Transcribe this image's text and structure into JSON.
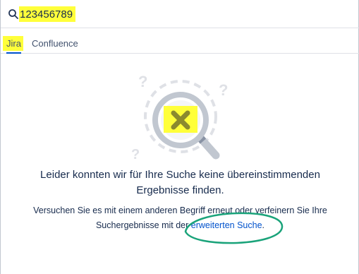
{
  "search": {
    "value": "123456789",
    "icon": "search-icon"
  },
  "tabs": [
    {
      "label": "Jira",
      "active": true
    },
    {
      "label": "Confluence",
      "active": false
    }
  ],
  "empty_state": {
    "title_line1": "Leider konnten wir für Ihre Suche keine übereinstimmenden",
    "title_line2": "Ergebnisse finden.",
    "body_line1": "Versuchen Sie es mit einem anderen Begriff erneut oder verfeinern Sie Ihre",
    "body_line2_prefix": "Suchergebnisse mit der ",
    "link_text": "erweiterten Suche",
    "body_line2_suffix": ".",
    "illustration_icon": "no-results-magnifier-icon"
  },
  "colors": {
    "highlight": "#ffff3a",
    "accent": "#0052cc",
    "annotation": "#1aa37a"
  }
}
